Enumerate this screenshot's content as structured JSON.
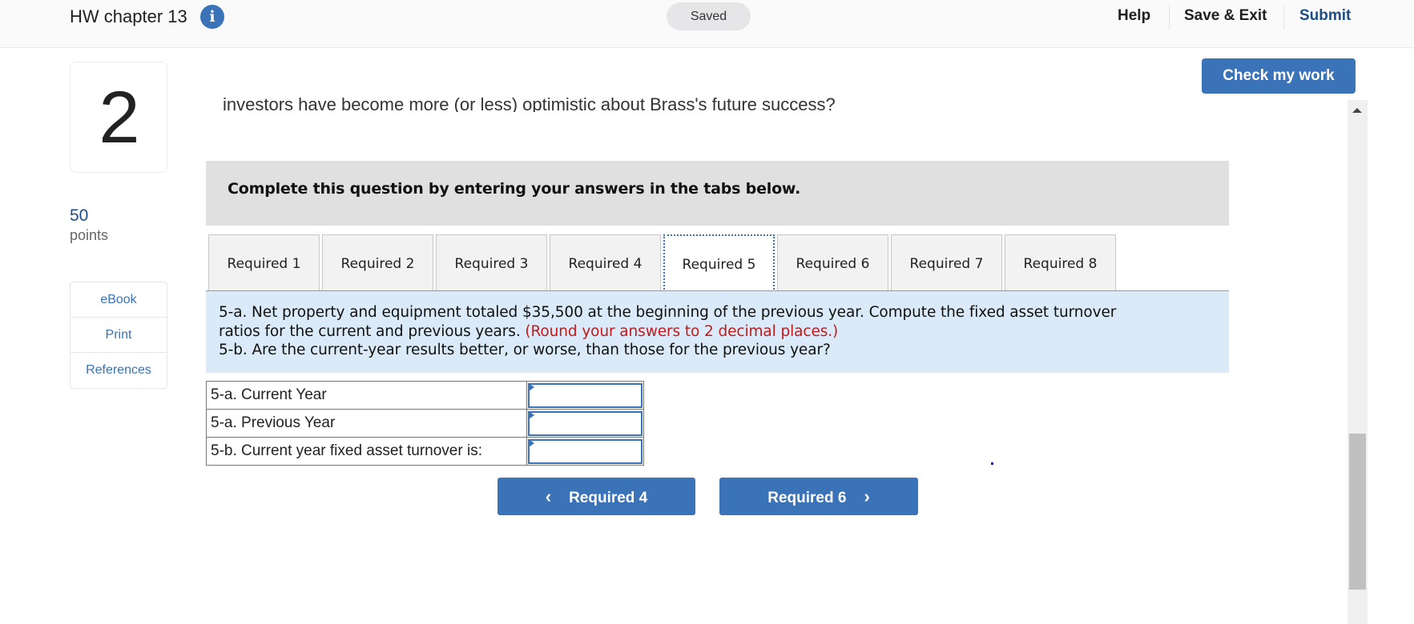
{
  "header": {
    "title": "HW chapter 13",
    "info_icon": "info-icon",
    "status": "Saved",
    "links": {
      "help": "Help",
      "save_exit": "Save & Exit",
      "submit": "Submit"
    }
  },
  "check_my_work": "Check my work",
  "question": {
    "number": "2",
    "points_value": "50",
    "points_label": "points",
    "side_links": [
      "eBook",
      "Print",
      "References"
    ],
    "partial_text": "investors have become more (or less) optimistic about Brass's future success?"
  },
  "banner": "Complete this question by entering your answers in the tabs below.",
  "tabs": [
    {
      "label": "Required 1",
      "active": false
    },
    {
      "label": "Required 2",
      "active": false
    },
    {
      "label": "Required 3",
      "active": false
    },
    {
      "label": "Required 4",
      "active": false
    },
    {
      "label": "Required 5",
      "active": true
    },
    {
      "label": "Required 6",
      "active": false
    },
    {
      "label": "Required 7",
      "active": false
    },
    {
      "label": "Required 8",
      "active": false
    }
  ],
  "instructions": {
    "line1": "5-a. Net property and equipment totaled $35,500 at the beginning of the previous year. Compute the fixed asset turnover",
    "line2_black": "ratios for the current and previous years. ",
    "line2_red": "(Round your answers to 2 decimal places.)",
    "line3": "5-b. Are the current-year results better, or worse, than those for the previous year?"
  },
  "answer_rows": [
    {
      "label": "5-a. Current Year",
      "value": ""
    },
    {
      "label": "5-a. Previous Year",
      "value": ""
    },
    {
      "label": "5-b. Current year fixed asset turnover is:",
      "value": ""
    }
  ],
  "nav": {
    "prev_label": "Required 4",
    "next_label": "Required 6",
    "prev_icon": "‹",
    "next_icon": "›"
  },
  "colors": {
    "brand_blue": "#3a73b8",
    "submit_blue": "#1d4d86",
    "instruction_bg": "#daeaf8",
    "banner_bg": "#e0e0e0",
    "warning_red": "#c01a1a"
  }
}
